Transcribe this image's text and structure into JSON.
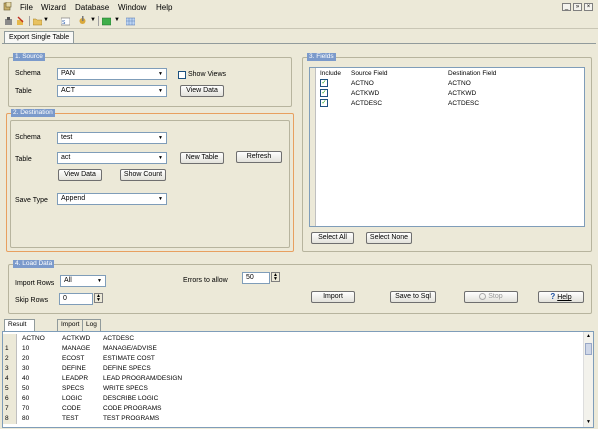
{
  "menubar": {
    "items": [
      "File",
      "Wizard",
      "Database",
      "Window",
      "Help"
    ],
    "window_controls": [
      "_",
      "»",
      "×"
    ]
  },
  "toolbar": {
    "icons": [
      "connect-icon",
      "disconnect-icon",
      "open-icon",
      "sql-icon",
      "settings-icon",
      "export-icon",
      "grid-icon"
    ]
  },
  "main_tab": {
    "label": "Export Single Table"
  },
  "source": {
    "title": "1. Source",
    "schema_label": "Schema",
    "schema_value": "PAN",
    "table_label": "Table",
    "table_value": "ACT",
    "show_views_label": "Show Views",
    "show_views_checked": false,
    "view_data_label": "View Data"
  },
  "destination": {
    "title": "2. Destination",
    "schema_label": "Schema",
    "schema_value": "test",
    "table_label": "Table",
    "table_value": "act",
    "new_table_label": "New Table",
    "refresh_label": "Refresh",
    "view_data_label": "View Data",
    "show_count_label": "Show Count",
    "save_type_label": "Save Type",
    "save_type_value": "Append"
  },
  "fields": {
    "title": "3. Fields",
    "columns": [
      "Include",
      "Source Field",
      "Destination Field"
    ],
    "rows": [
      {
        "include": true,
        "source": "ACTNO",
        "destination": "ACTNO"
      },
      {
        "include": true,
        "source": "ACTKWD",
        "destination": "ACTKWD"
      },
      {
        "include": true,
        "source": "ACTDESC",
        "destination": "ACTDESC"
      }
    ],
    "select_all_label": "Select All",
    "select_none_label": "Select None"
  },
  "load": {
    "title": "4. Load Data",
    "import_rows_label": "Import Rows",
    "import_rows_value": "All",
    "skip_rows_label": "Skip Rows",
    "skip_rows_value": "0",
    "errors_label": "Errors to allow",
    "errors_value": "50",
    "import_label": "Import",
    "save_to_sql_label": "Save to Sql",
    "stop_label": "Stop",
    "help_label": "Help"
  },
  "result_tabs": [
    "Result Preview",
    "Import",
    "Log"
  ],
  "result": {
    "columns": [
      "ACTNO",
      "ACTKWD",
      "ACTDESC"
    ],
    "rows": [
      [
        "1",
        "10",
        "MANAGE",
        "MANAGE/ADVISE"
      ],
      [
        "2",
        "20",
        "ECOST",
        "ESTIMATE COST"
      ],
      [
        "3",
        "30",
        "DEFINE",
        "DEFINE SPECS"
      ],
      [
        "4",
        "40",
        "LEADPR",
        "LEAD PROGRAM/DESIGN"
      ],
      [
        "5",
        "50",
        "SPECS",
        "WRITE SPECS"
      ],
      [
        "6",
        "60",
        "LOGIC",
        "DESCRIBE LOGIC"
      ],
      [
        "7",
        "70",
        "CODE",
        "CODE PROGRAMS"
      ],
      [
        "8",
        "80",
        "TEST",
        "TEST PROGRAMS"
      ]
    ]
  },
  "colors": {
    "group_title_bg": "#7b9acb",
    "destination_border": "#e8a060",
    "check_green": "#21a121"
  }
}
